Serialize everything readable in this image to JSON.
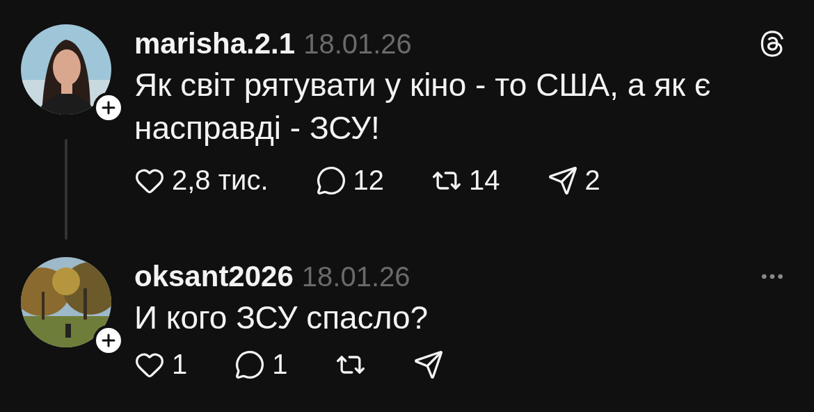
{
  "posts": [
    {
      "username": "marisha.2.1",
      "date": "18.01.26",
      "text": "Як світ рятувати у кіно - то США, а як є насправді - ЗСУ!",
      "threads_logo": true,
      "more_menu": false,
      "thread_line": true,
      "actions": [
        {
          "kind": "like",
          "count": "2,8 тис."
        },
        {
          "kind": "comment",
          "count": "12"
        },
        {
          "kind": "repost",
          "count": "14"
        },
        {
          "kind": "share",
          "count": "2"
        }
      ]
    },
    {
      "username": "oksant2026",
      "date": "18.01.26",
      "text": "И кого ЗСУ спасло?",
      "threads_logo": false,
      "more_menu": true,
      "thread_line": false,
      "actions": [
        {
          "kind": "like",
          "count": "1"
        },
        {
          "kind": "comment",
          "count": "1"
        },
        {
          "kind": "repost"
        },
        {
          "kind": "share"
        }
      ]
    }
  ]
}
